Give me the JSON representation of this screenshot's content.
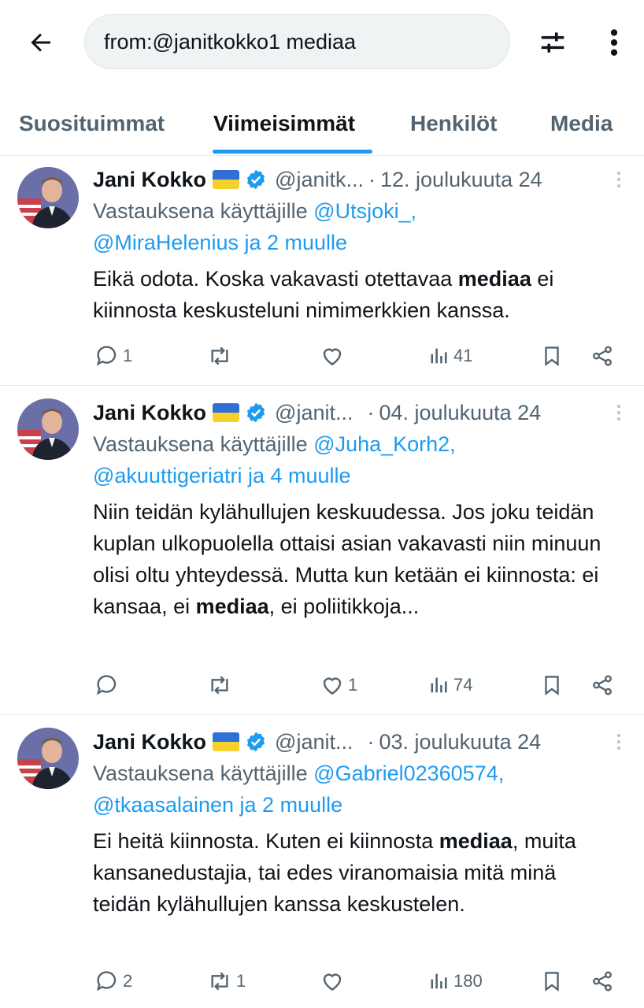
{
  "search": {
    "query": "from:@janitkokko1 mediaa"
  },
  "tabs": [
    {
      "label": "Suosituimmat"
    },
    {
      "label": "Viimeisimmät"
    },
    {
      "label": "Henkilöt"
    },
    {
      "label": "Media"
    }
  ],
  "active_tab": "Viimeisimmät",
  "colors": {
    "accent": "#1d9bf0",
    "muted": "#536471",
    "text": "#0f1419"
  },
  "tweets": [
    {
      "name": "Jani Kokko",
      "handle": "@janitk...",
      "dot": "·",
      "date": "12. joulukuuta 24",
      "reply_prefix": "Vastauksena käyttäjille ",
      "mention1": "@Utsjoki_",
      "sep": ",",
      "mention2": "@MiraHelenius",
      "reply_suffix": " ja 2 muulle",
      "text_before": "Eikä odota. Koska vakavasti otettavaa ",
      "highlight": "mediaa",
      "text_after": " ei kiinnosta keskusteluni nimimerkkien kanssa.",
      "replies": "1",
      "reposts": "",
      "likes": "",
      "views": "41"
    },
    {
      "name": "Jani Kokko",
      "handle": "@janit...",
      "dot": "·",
      "date": "04. joulukuuta 24",
      "reply_prefix": "Vastauksena käyttäjille ",
      "mention1": "@Juha_Korh2",
      "sep": ",",
      "mention2": "@akuuttigeriatri",
      "reply_suffix": " ja 4 muulle",
      "text_before": "Niin teidän kylähullujen keskuudessa. Jos joku teidän kuplan ulkopuolella ottaisi asian vakavasti niin minuun olisi oltu yhteydessä. Mutta kun ketään ei kiinnosta: ei kansaa, ei ",
      "highlight": "mediaa",
      "text_after": ", ei poliitikkoja...",
      "replies": "",
      "reposts": "",
      "likes": "1",
      "views": "74"
    },
    {
      "name": "Jani Kokko",
      "handle": "@janit...",
      "dot": "·",
      "date": "03. joulukuuta 24",
      "reply_prefix": "Vastauksena käyttäjille ",
      "mention1": "@Gabriel02360574",
      "sep": ",",
      "mention2": "@tkaasalainen",
      "reply_suffix": " ja 2 muulle",
      "text_before": "Ei heitä kiinnosta. Kuten ei kiinnosta ",
      "highlight": "mediaa",
      "text_after": ", muita kansanedustajia, tai edes viranomaisia mitä minä teidän kylähullujen kanssa keskustelen.",
      "replies": "2",
      "reposts": "1",
      "likes": "",
      "views": "180"
    }
  ]
}
